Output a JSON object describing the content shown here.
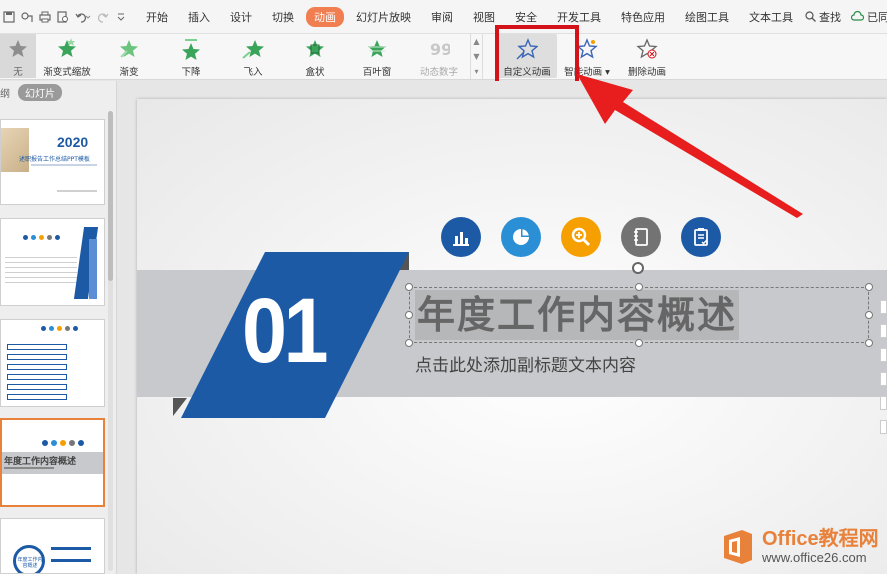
{
  "menu": {
    "quick_access_icons": [
      "save-icon",
      "format-painter-icon",
      "print-icon",
      "print-preview-icon",
      "undo-icon",
      "redo-icon",
      "more-icon"
    ],
    "tabs": [
      {
        "label": "开始"
      },
      {
        "label": "插入"
      },
      {
        "label": "设计"
      },
      {
        "label": "切换"
      },
      {
        "label": "动画",
        "active": true
      },
      {
        "label": "幻灯片放映"
      },
      {
        "label": "审阅"
      },
      {
        "label": "视图"
      },
      {
        "label": "安全"
      },
      {
        "label": "开发工具"
      },
      {
        "label": "特色应用"
      },
      {
        "label": "绘图工具"
      },
      {
        "label": "文本工具"
      }
    ],
    "search_label": "查找",
    "sync_label": "已同步",
    "accent_color": "#f07e51"
  },
  "ribbon": {
    "none_label": "无",
    "gallery": [
      {
        "label": "渐变式缩放"
      },
      {
        "label": "渐变"
      },
      {
        "label": "下降"
      },
      {
        "label": "飞入"
      },
      {
        "label": "盒状"
      },
      {
        "label": "百叶窗"
      },
      {
        "label": "动态数字",
        "disabled": true
      }
    ],
    "custom_animation": "自定义动画",
    "smart_animation": "智能动画",
    "delete_animation": "删除动画"
  },
  "left_panel": {
    "tab_outline": "纲",
    "tab_slides": "幻灯片",
    "thumbnails": [
      {
        "year": "2020",
        "subtitle": "述职报告工作总结PPT模板"
      },
      {},
      {},
      {
        "title": "年度工作内容概述",
        "selected": true
      },
      {
        "caption": "年度工作内容概述"
      }
    ]
  },
  "slide": {
    "number": "01",
    "title": "年度工作内容概述",
    "subtitle": "点击此处添加副标题文本内容",
    "icons": [
      {
        "name": "bar-chart-icon",
        "color": "#1c5aa6"
      },
      {
        "name": "pie-chart-icon",
        "color": "#2b8fd6"
      },
      {
        "name": "magnify-icon",
        "color": "#f5a000"
      },
      {
        "name": "notebook-icon",
        "color": "#737373"
      },
      {
        "name": "checklist-icon",
        "color": "#1c5aa6"
      }
    ],
    "accent_blue": "#1c5aa6"
  },
  "watermark": {
    "brand": "Office教程网",
    "url": "www.office26.com"
  }
}
